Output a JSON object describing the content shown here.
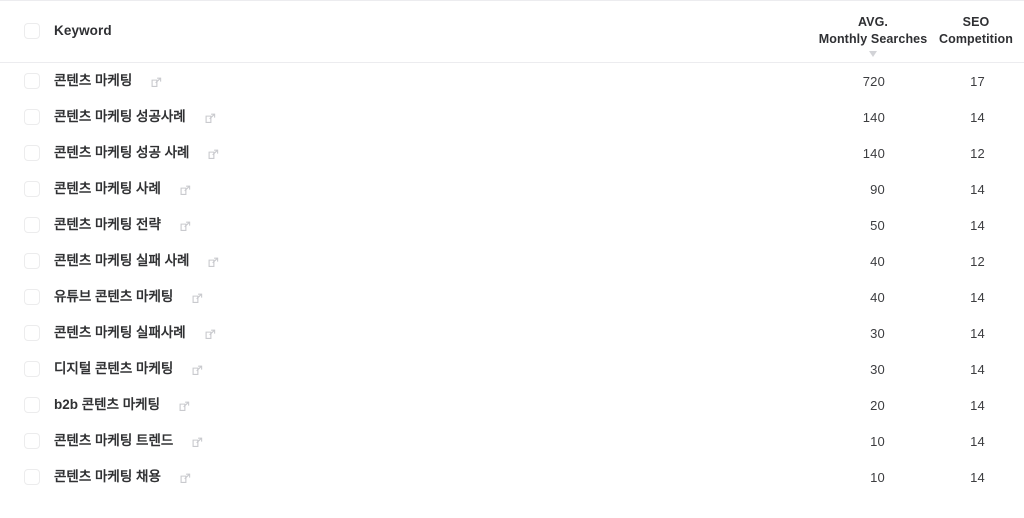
{
  "table": {
    "columns": {
      "keyword": "Keyword",
      "avg_monthly_searches_line1": "AVG.",
      "avg_monthly_searches_line2": "Monthly Searches",
      "seo_competition_line1": "SEO",
      "seo_competition_line2": "Competition"
    },
    "sort": {
      "column": "Monthly Searches",
      "direction": "desc",
      "icon": "caret-down-icon"
    },
    "icons": {
      "checkbox": "checkbox-icon",
      "external_link": "external-link-icon"
    },
    "rows": [
      {
        "keyword": "콘텐츠 마케팅",
        "avg_monthly_searches": "720",
        "seo_competition": "17"
      },
      {
        "keyword": "콘텐츠 마케팅 성공사례",
        "avg_monthly_searches": "140",
        "seo_competition": "14"
      },
      {
        "keyword": "콘텐츠 마케팅 성공 사례",
        "avg_monthly_searches": "140",
        "seo_competition": "12"
      },
      {
        "keyword": "콘텐츠 마케팅 사례",
        "avg_monthly_searches": "90",
        "seo_competition": "14"
      },
      {
        "keyword": "콘텐츠 마케팅 전략",
        "avg_monthly_searches": "50",
        "seo_competition": "14"
      },
      {
        "keyword": "콘텐츠 마케팅 실패 사례",
        "avg_monthly_searches": "40",
        "seo_competition": "12"
      },
      {
        "keyword": "유튜브 콘텐츠 마케팅",
        "avg_monthly_searches": "40",
        "seo_competition": "14"
      },
      {
        "keyword": "콘텐츠 마케팅 실패사례",
        "avg_monthly_searches": "30",
        "seo_competition": "14"
      },
      {
        "keyword": "디지털 콘텐츠 마케팅",
        "avg_monthly_searches": "30",
        "seo_competition": "14"
      },
      {
        "keyword": "b2b 콘텐츠 마케팅",
        "avg_monthly_searches": "20",
        "seo_competition": "14"
      },
      {
        "keyword": "콘텐츠 마케팅 트렌드",
        "avg_monthly_searches": "10",
        "seo_competition": "14"
      },
      {
        "keyword": "콘텐츠 마케팅 채용",
        "avg_monthly_searches": "10",
        "seo_competition": "14"
      }
    ]
  },
  "colors": {
    "text_primary": "#303133",
    "text_secondary": "#3c3d40",
    "border": "#ececef",
    "checkbox_border": "#ececed",
    "icon_muted": "#c9cace"
  }
}
